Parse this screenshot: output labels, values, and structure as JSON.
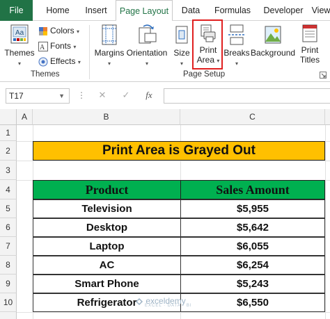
{
  "tabs": {
    "file": "File",
    "home": "Home",
    "insert": "Insert",
    "page_layout": "Page Layout",
    "data": "Data",
    "formulas": "Formulas",
    "developer": "Developer",
    "view": "View"
  },
  "ribbon": {
    "themes_group": {
      "themes": "Themes",
      "colors": "Colors",
      "fonts": "Fonts",
      "effects": "Effects",
      "label": "Themes"
    },
    "page_setup_group": {
      "margins": "Margins",
      "orientation": "Orientation",
      "size": "Size",
      "print_area_line1": "Print",
      "print_area_line2": "Area",
      "breaks": "Breaks",
      "background": "Background",
      "print_titles_line1": "Print",
      "print_titles_line2": "Titles",
      "label": "Page Setup"
    }
  },
  "formula_bar": {
    "name_box": "T17",
    "cancel_icon": "✕",
    "enter_icon": "✓",
    "fx": "fx",
    "value": ""
  },
  "columns": [
    "A",
    "B",
    "C"
  ],
  "rows": [
    "1",
    "2",
    "3",
    "4",
    "5",
    "6",
    "7",
    "8",
    "9",
    "10"
  ],
  "sheet": {
    "title": "Print Area is Grayed Out",
    "headers": [
      "Product",
      "Sales Amount"
    ],
    "data": [
      {
        "product": "Television",
        "sales": "$5,955"
      },
      {
        "product": "Desktop",
        "sales": "$5,642"
      },
      {
        "product": "Laptop",
        "sales": "$6,055"
      },
      {
        "product": "AC",
        "sales": "$6,254"
      },
      {
        "product": "Smart Phone",
        "sales": "$5,243"
      },
      {
        "product": "Refrigerator",
        "sales": "$6,550"
      }
    ]
  },
  "watermark": {
    "name": "exceldemy",
    "tagline": "EXCEL · DATA · BI"
  },
  "colors": {
    "excel_green": "#217346",
    "title_fill": "#ffc000",
    "header_fill": "#00b050",
    "highlight": "#e02020"
  }
}
